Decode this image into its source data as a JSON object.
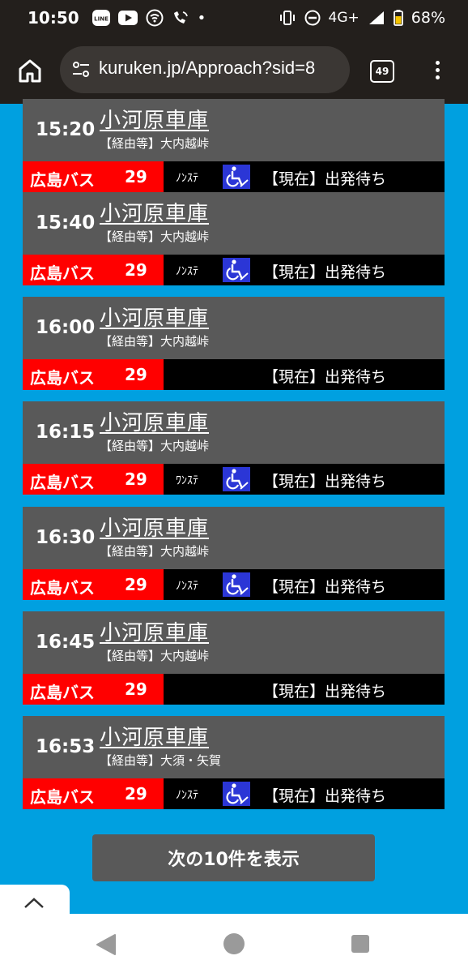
{
  "status_bar": {
    "time": "10:50",
    "network": "4G+",
    "battery": "68%",
    "dot": "•"
  },
  "browser": {
    "url": "kuruken.jp/Approach?sid=8",
    "tab_count": "49"
  },
  "departures": [
    {
      "time": "15:20",
      "destination": "小河原車庫",
      "via": "【経由等】大内越峠",
      "company": "広島バス",
      "route": "29",
      "stop_type": "ﾉﾝｽﾃ",
      "wheelchair": true,
      "status": "【現在】出発待ち"
    },
    {
      "time": "15:40",
      "destination": "小河原車庫",
      "via": "【経由等】大内越峠",
      "company": "広島バス",
      "route": "29",
      "stop_type": "ﾉﾝｽﾃ",
      "wheelchair": true,
      "status": "【現在】出発待ち"
    },
    {
      "time": "16:00",
      "destination": "小河原車庫",
      "via": "【経由等】大内越峠",
      "company": "広島バス",
      "route": "29",
      "stop_type": "",
      "wheelchair": false,
      "status": "【現在】出発待ち"
    },
    {
      "time": "16:15",
      "destination": "小河原車庫",
      "via": "【経由等】大内越峠",
      "company": "広島バス",
      "route": "29",
      "stop_type": "ﾜﾝｽﾃ",
      "wheelchair": true,
      "status": "【現在】出発待ち"
    },
    {
      "time": "16:30",
      "destination": "小河原車庫",
      "via": "【経由等】大内越峠",
      "company": "広島バス",
      "route": "29",
      "stop_type": "ﾉﾝｽﾃ",
      "wheelchair": true,
      "status": "【現在】出発待ち"
    },
    {
      "time": "16:45",
      "destination": "小河原車庫",
      "via": "【経由等】大内越峠",
      "company": "広島バス",
      "route": "29",
      "stop_type": "",
      "wheelchair": false,
      "status": "【現在】出発待ち"
    },
    {
      "time": "16:53",
      "destination": "小河原車庫",
      "via": "【経由等】大須・矢賀",
      "company": "広島バス",
      "route": "29",
      "stop_type": "ﾉﾝｽﾃ",
      "wheelchair": true,
      "status": "【現在】出発待ち"
    }
  ],
  "next_button": "次の10件を表示",
  "icons": {
    "line": "line-app-icon",
    "youtube": "youtube-icon",
    "wifi_calling": "wifi-calling-icon",
    "vibrate": "vibrate-icon",
    "dnd": "do-not-disturb-icon",
    "wheelchair": "wheelchair-icon"
  },
  "colors": {
    "background": "#00a0e0",
    "company_cell": "#ff0000",
    "card": "#595959",
    "wheelchair": "#2b36d6"
  }
}
